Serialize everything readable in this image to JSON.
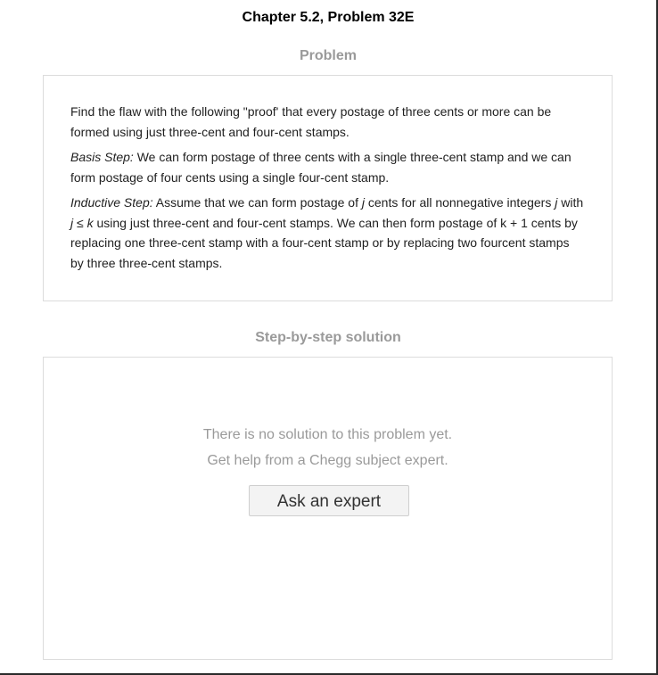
{
  "page": {
    "title": "Chapter 5.2, Problem 32E"
  },
  "problem": {
    "heading": "Problem",
    "intro": "Find the flaw with the following \"proof' that every postage of three cents or more can be formed using just three-cent and four-cent stamps.",
    "basis_label": "Basis Step:",
    "basis_text": " We can form postage of three cents with a single three-cent stamp and we can form postage of four cents using a single four-cent stamp.",
    "inductive_label": "Inductive Step:",
    "inductive_part1": " Assume that we can form postage of ",
    "var_j1": "j",
    "inductive_part2": " cents for all nonnegative integers ",
    "var_j2": "j",
    "inductive_part3": " with ",
    "var_j3": "j",
    "leq": " ≤ ",
    "var_k": "k",
    "inductive_part4": " using just three-cent and four-cent stamps. We can then form postage of k + 1 cents by replacing one three-cent stamp with a four-cent stamp or by replacing two fourcent stamps by three three-cent stamps."
  },
  "solution": {
    "heading": "Step-by-step solution",
    "no_solution_text": "There is no solution to this problem yet.",
    "help_text": "Get help from a Chegg subject expert.",
    "ask_button_label": "Ask an expert"
  }
}
